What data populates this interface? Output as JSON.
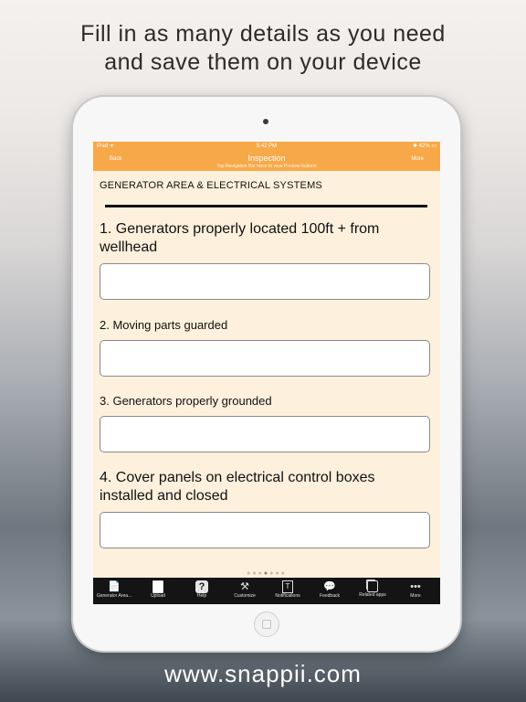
{
  "headline": {
    "line1": "Fill in as many details as you need",
    "line2": "and save them on your device"
  },
  "footer_url": "www.snappii.com",
  "status_bar": {
    "carrier": "iPad ᯤ",
    "time": "5:42 PM",
    "battery": "✱ 42% ▭"
  },
  "nav": {
    "back": "Back",
    "title": "Inspection",
    "subtitle": "Tap Navigation Bar twice to view Preview buttons",
    "more": "More"
  },
  "form": {
    "section_title": "GENERATOR AREA & ELECTRICAL SYSTEMS",
    "questions": [
      {
        "label": "1. Generators properly located 100ft + from wellhead",
        "value": ""
      },
      {
        "label": "2. Moving parts guarded",
        "value": ""
      },
      {
        "label": "3. Generators properly grounded",
        "value": ""
      },
      {
        "label": "4. Cover panels on electrical control boxes installed and closed",
        "value": ""
      }
    ]
  },
  "pager": {
    "dots": 7,
    "active_index": 3
  },
  "tabs": [
    {
      "label": "Generator Area...",
      "icon": "file-icon"
    },
    {
      "label": "Upload",
      "icon": "upload-icon"
    },
    {
      "label": "Help",
      "icon": "help-icon"
    },
    {
      "label": "Customize",
      "icon": "tools-icon"
    },
    {
      "label": "Notifications",
      "icon": "notifications-icon"
    },
    {
      "label": "Feedback",
      "icon": "feedback-icon"
    },
    {
      "label": "Related apps",
      "icon": "related-apps-icon"
    },
    {
      "label": "More",
      "icon": "more-icon"
    }
  ],
  "colors": {
    "accent": "#f7a949",
    "screen_bg": "#fdf0dc",
    "tabbar_bg": "#141414"
  }
}
